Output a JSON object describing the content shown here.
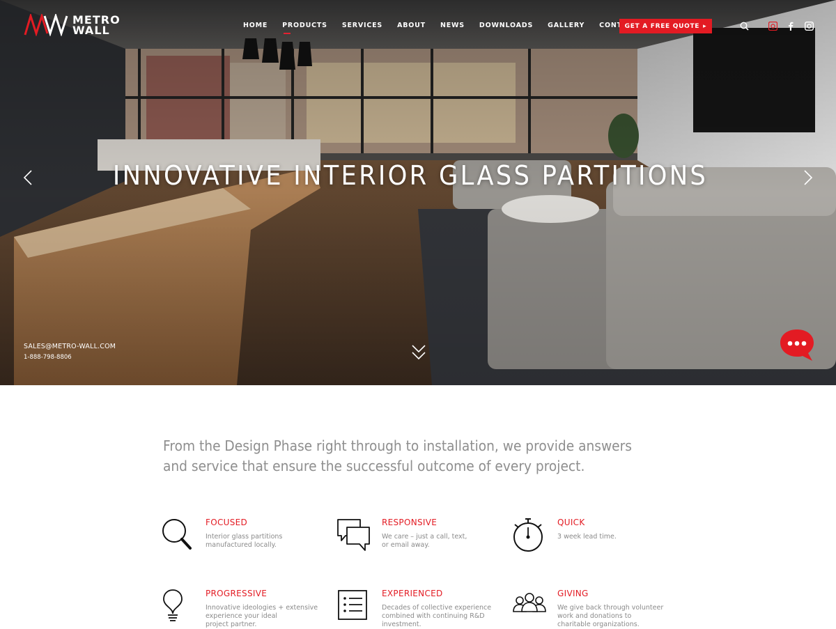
{
  "brand": {
    "line1": "METRO",
    "line2": "WALL"
  },
  "nav": {
    "items": [
      {
        "label": "HOME"
      },
      {
        "label": "PRODUCTS"
      },
      {
        "label": "SERVICES"
      },
      {
        "label": "ABOUT"
      },
      {
        "label": "NEWS"
      },
      {
        "label": "DOWNLOADS"
      },
      {
        "label": "GALLERY"
      },
      {
        "label": "CONTACT"
      }
    ],
    "active": "PRODUCTS",
    "cta_label": "GET A FREE QUOTE",
    "cta_arrow": "▸"
  },
  "header_icons": [
    "search-icon",
    "google-plus-icon",
    "facebook-icon",
    "instagram-icon"
  ],
  "hero": {
    "title": "INNOVATIVE INTERIOR GLASS PARTITIONS",
    "email": "SALES@METRO-WALL.COM",
    "phone": "1-888-798-8806"
  },
  "intro_text": "From the Design Phase right through to installation, we provide answers and service that ensure the successful outcome of every project.",
  "features": [
    {
      "icon": "magnifier-icon",
      "title": "FOCUSED",
      "desc": "Interior glass partitions\nmanufactured locally."
    },
    {
      "icon": "speech-bubbles-icon",
      "title": "RESPONSIVE",
      "desc": "We care – just a call, text,\nor email away."
    },
    {
      "icon": "stopwatch-icon",
      "title": "QUICK",
      "desc": "3 week lead time."
    },
    {
      "icon": "lightbulb-icon",
      "title": "PROGRESSIVE",
      "desc": "Innovative ideologies + extensive\nexperience your ideal\nproject partner."
    },
    {
      "icon": "checklist-icon",
      "title": "EXPERIENCED",
      "desc": "Decades of collective experience\ncombined with continuing R&D\ninvestment."
    },
    {
      "icon": "people-icon",
      "title": "GIVING",
      "desc": "We give back through volunteer\nwork and donations to\ncharitable organizations."
    }
  ],
  "colors": {
    "accent": "#e31b23",
    "text_gray": "#8a8a8a",
    "white": "#ffffff"
  }
}
